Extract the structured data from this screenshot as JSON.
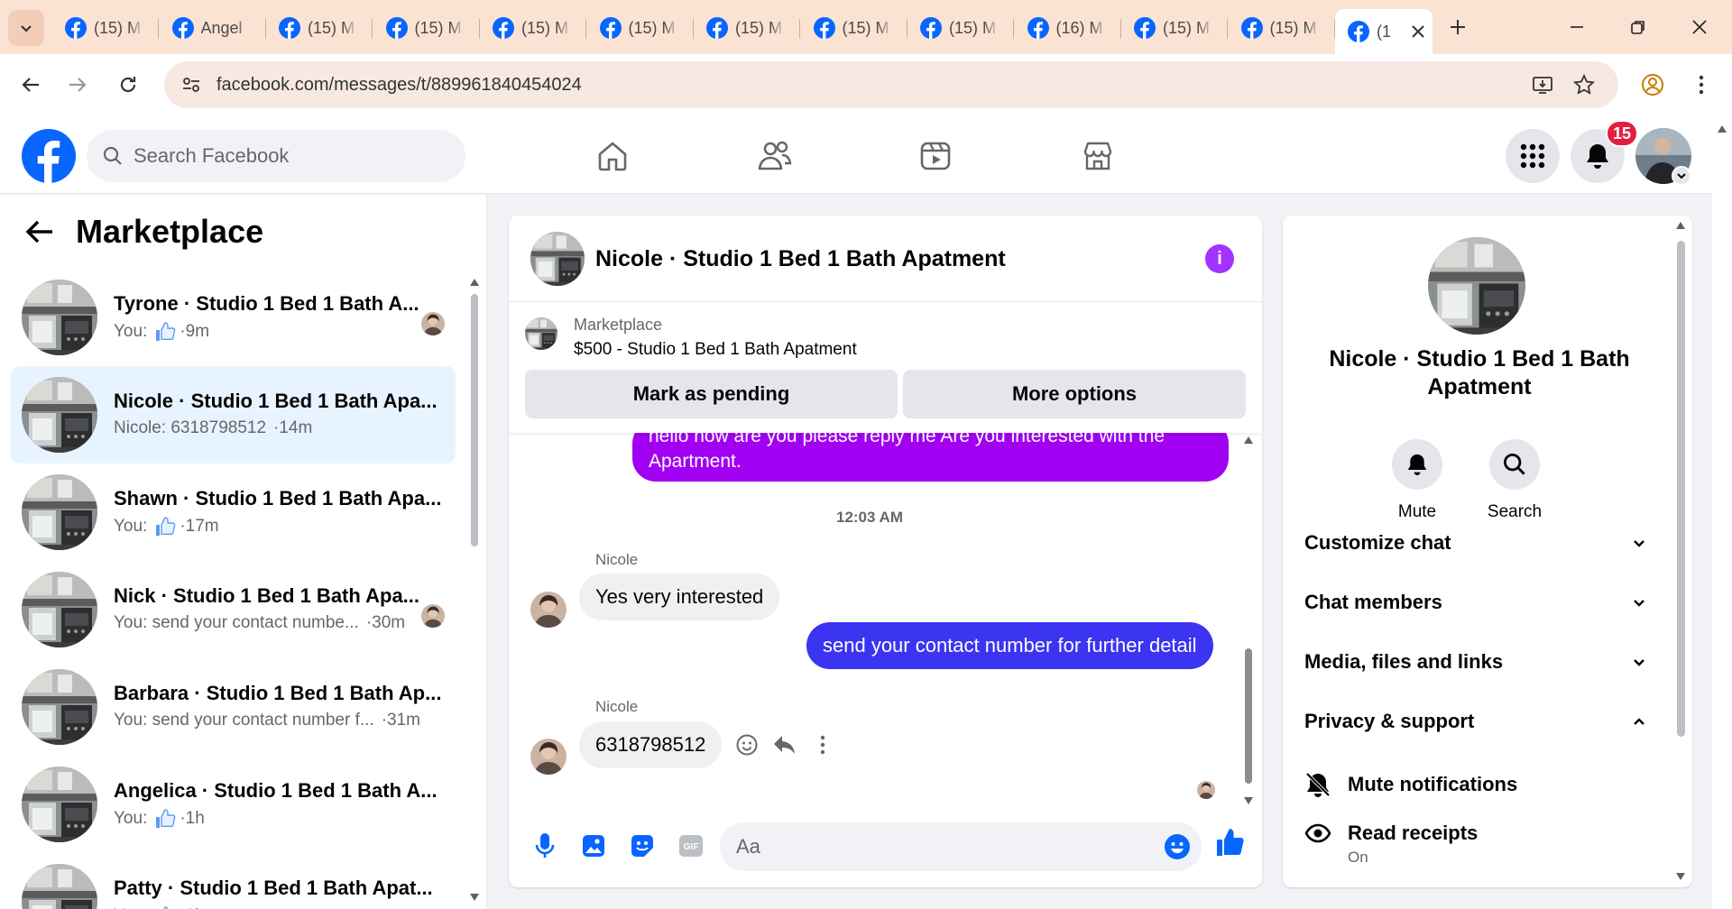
{
  "browser": {
    "tabs": [
      {
        "label": "(15) M"
      },
      {
        "label": "Angel"
      },
      {
        "label": "(15) M"
      },
      {
        "label": "(15) M"
      },
      {
        "label": "(15) M"
      },
      {
        "label": "(15) M"
      },
      {
        "label": "(15) M"
      },
      {
        "label": "(15) M"
      },
      {
        "label": "(15) M"
      },
      {
        "label": "(16) M"
      },
      {
        "label": "(15) M"
      },
      {
        "label": "(15) M"
      },
      {
        "label": "(1"
      }
    ],
    "url": "facebook.com/messages/t/889961840454024"
  },
  "header": {
    "search_placeholder": "Search Facebook",
    "notification_count": "15"
  },
  "sidebar": {
    "title": "Marketplace",
    "conversations": [
      {
        "name": "Tyrone · Studio 1 Bed 1 Bath A...",
        "prefix": "You:",
        "thumb": true,
        "preview": "",
        "time": "·9m",
        "seen": true
      },
      {
        "name": "Nicole · Studio 1 Bed 1 Bath Apa...",
        "prefix": "",
        "thumb": false,
        "preview": "Nicole: 6318798512",
        "time": "·14m",
        "seen": false
      },
      {
        "name": "Shawn · Studio 1 Bed 1 Bath Apa...",
        "prefix": "You:",
        "thumb": true,
        "preview": "",
        "time": "·17m",
        "seen": false
      },
      {
        "name": "Nick · Studio 1 Bed 1 Bath Apa...",
        "prefix": "",
        "thumb": false,
        "preview": "You: send your contact numbe...",
        "time": "·30m",
        "seen": true
      },
      {
        "name": "Barbara · Studio 1 Bed 1 Bath Ap...",
        "prefix": "",
        "thumb": false,
        "preview": "You: send your contact number f...",
        "time": "·31m",
        "seen": false
      },
      {
        "name": "Angelica · Studio 1 Bed 1 Bath A...",
        "prefix": "You:",
        "thumb": true,
        "preview": "",
        "time": "·1h",
        "seen": false
      },
      {
        "name": "Patty · Studio 1 Bed 1 Bath Apat...",
        "prefix": "You:",
        "thumb": true,
        "preview": "",
        "time": "·1h",
        "seen": false
      }
    ]
  },
  "chat": {
    "title": "Nicole · Studio 1 Bed 1 Bath Apatment",
    "listing": {
      "category": "Marketplace",
      "price_title": "$500 - Studio 1 Bed 1 Bath Apatment",
      "mark_pending": "Mark as pending",
      "more_options": "More options"
    },
    "messages": {
      "out1_line1": "hello how are you please reply me Are you interested  with the",
      "out1_line2": "Apartment.",
      "time": "12:03 AM",
      "sender": "Nicole",
      "in1": "Yes very interested",
      "out2": "send your contact number for further detail",
      "in2": "6318798512"
    },
    "composer_placeholder": "Aa",
    "colors": {
      "outgoing_purple": "#a100f2",
      "outgoing_blue": "#3b34f0",
      "accent": "#0866ff"
    }
  },
  "details": {
    "name": "Nicole · Studio 1 Bed 1 Bath Apatment",
    "mute_label": "Mute",
    "search_label": "Search",
    "sections": {
      "customize": "Customize chat",
      "members": "Chat members",
      "media": "Media, files and links",
      "privacy": "Privacy & support"
    },
    "items": {
      "mute_notifications": "Mute notifications",
      "read_receipts": "Read receipts",
      "read_receipts_value": "On"
    }
  }
}
